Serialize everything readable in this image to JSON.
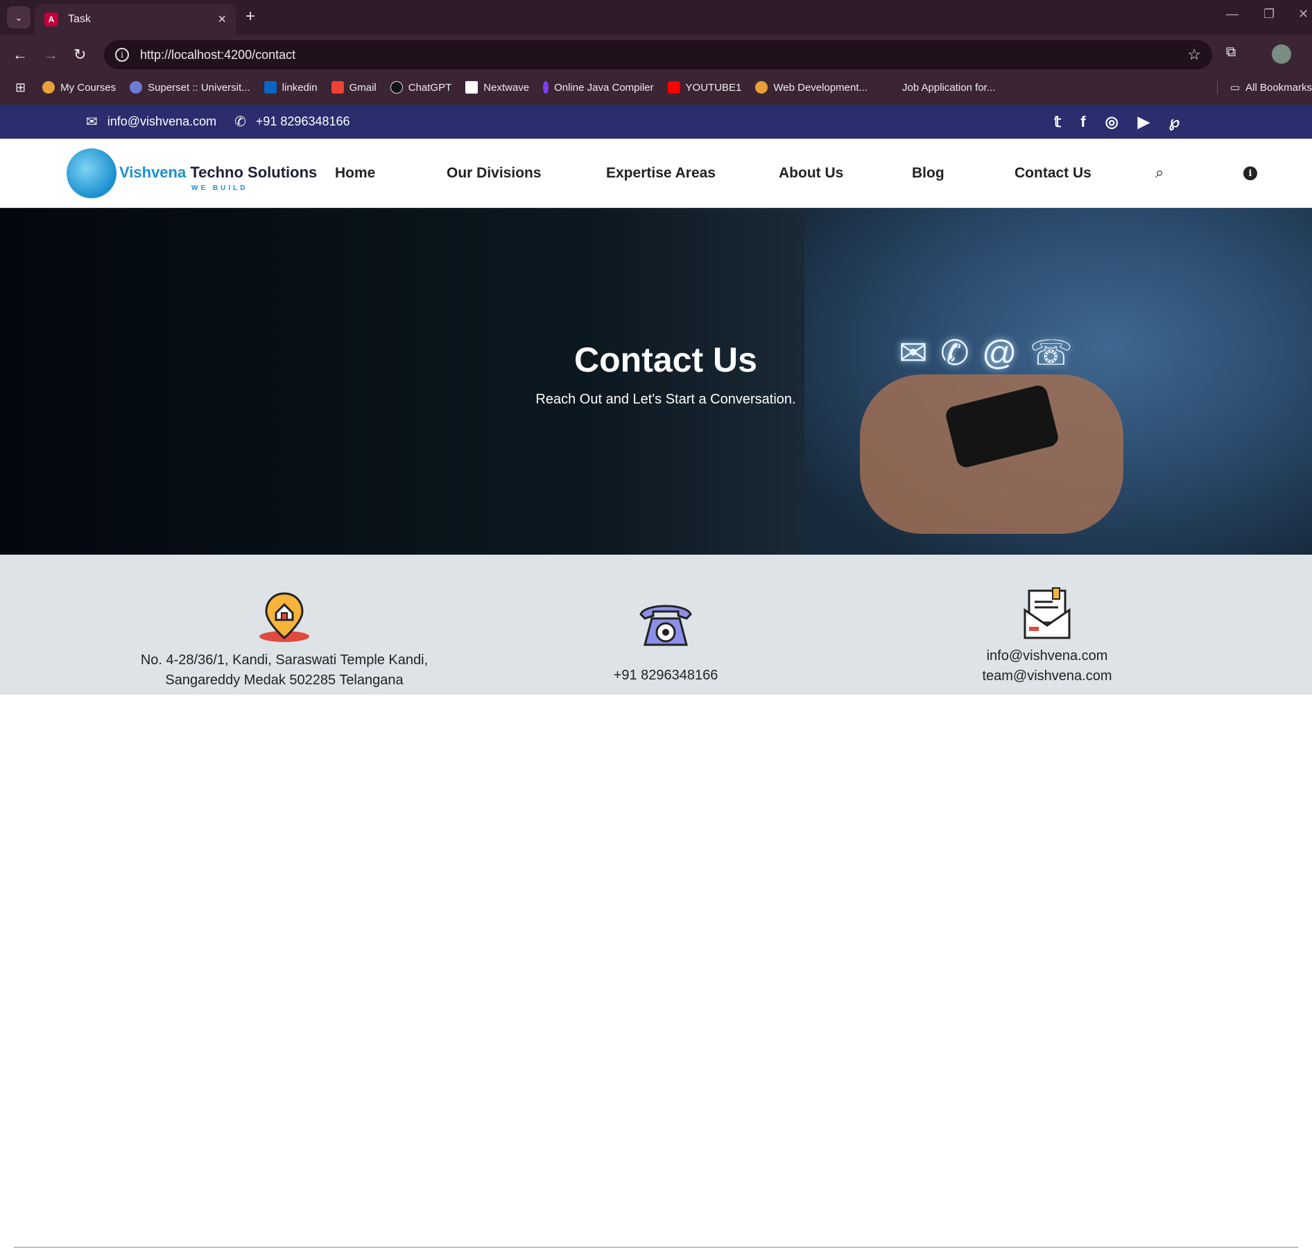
{
  "browser": {
    "tab_title": "Task",
    "url": "http://localhost:4200/contact",
    "bookmarks": [
      {
        "label": "My Courses",
        "color": "#e8a13a"
      },
      {
        "label": "Superset :: Universit...",
        "color": "#6b7bd6"
      },
      {
        "label": "linkedin",
        "color": "#0a66c2"
      },
      {
        "label": "Gmail",
        "color": "#ea4335"
      },
      {
        "label": "ChatGPT",
        "color": "#222222"
      },
      {
        "label": "Nextwave",
        "color": "#ffffff"
      },
      {
        "label": "Online Java Compiler",
        "color": "#7b3ff2"
      },
      {
        "label": "YOUTUBE1",
        "color": "#ff0000"
      },
      {
        "label": "Web Development...",
        "color": "#e8a13a"
      },
      {
        "label": "Job Application for...",
        "color": "#3b2433"
      }
    ],
    "all_bookmarks": "All Bookmarks"
  },
  "topbar": {
    "email": "info@vishvena.com",
    "phone": "+91 8296348166",
    "social": [
      "twitter-icon",
      "facebook-icon",
      "instagram-icon",
      "youtube-icon",
      "pinterest-icon"
    ]
  },
  "header": {
    "logo_name_1": "Vishvena",
    "logo_name_2": " Techno Solutions",
    "logo_tag": "WE BUILD",
    "nav": [
      "Home",
      "Our Divisions",
      "Expertise Areas",
      "About Us",
      "Blog",
      "Contact Us"
    ]
  },
  "hero": {
    "title": "Contact Us",
    "subtitle": "Reach Out and Let's Start a Conversation."
  },
  "info": {
    "address_line1": "No. 4-28/36/1, Kandi, Saraswati Temple Kandi,",
    "address_line2": "Sangareddy Medak 502285 Telangana",
    "phone": "+91 8296348166",
    "email1": "info@vishvena.com",
    "email2": "team@vishvena.com"
  },
  "colors": {
    "topbar": "#2b2d6e",
    "brand": "#1a8fcf",
    "info_band": "#dde3e6"
  }
}
